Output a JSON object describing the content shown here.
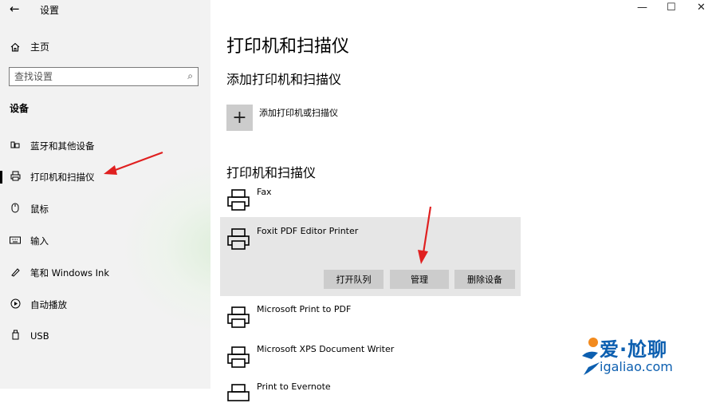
{
  "window": {
    "title": "设置",
    "back_icon": "←",
    "minimize_icon": "—",
    "maximize_icon": "☐",
    "close_icon": "✕"
  },
  "sidebar": {
    "home_label": "主页",
    "search_placeholder": "查找设置",
    "section_label": "设备",
    "items": [
      {
        "label": "蓝牙和其他设备",
        "icon": "bluetooth-devices-icon",
        "selected": false
      },
      {
        "label": "打印机和扫描仪",
        "icon": "printer-icon",
        "selected": true
      },
      {
        "label": "鼠标",
        "icon": "mouse-icon",
        "selected": false
      },
      {
        "label": "输入",
        "icon": "keyboard-icon",
        "selected": false
      },
      {
        "label": "笔和 Windows Ink",
        "icon": "pen-icon",
        "selected": false
      },
      {
        "label": "自动播放",
        "icon": "autoplay-icon",
        "selected": false
      },
      {
        "label": "USB",
        "icon": "usb-icon",
        "selected": false
      }
    ]
  },
  "main": {
    "page_title": "打印机和扫描仪",
    "add_section_title": "添加打印机和扫描仪",
    "add_button_label": "添加打印机或扫描仪",
    "list_section_title": "打印机和扫描仪",
    "printers": [
      {
        "name": "Fax"
      },
      {
        "name": "Foxit PDF Editor Printer"
      },
      {
        "name": "Microsoft Print to PDF"
      },
      {
        "name": "Microsoft XPS Document Writer"
      },
      {
        "name": "Print to Evernote"
      }
    ],
    "actions": {
      "open_queue": "打开队列",
      "manage": "管理",
      "remove_device": "删除设备"
    }
  },
  "watermark": {
    "brand": "爱·尬聊",
    "url": "igaliao.com"
  },
  "colors": {
    "sidebar_bg": "#f2f2f2",
    "annotation_arrow": "#e02020",
    "selected_item_bg": "#e6e6e6",
    "button_bg": "#cccccc",
    "watermark_blue": "#0c5fb0",
    "watermark_orange": "#f28a1e"
  }
}
